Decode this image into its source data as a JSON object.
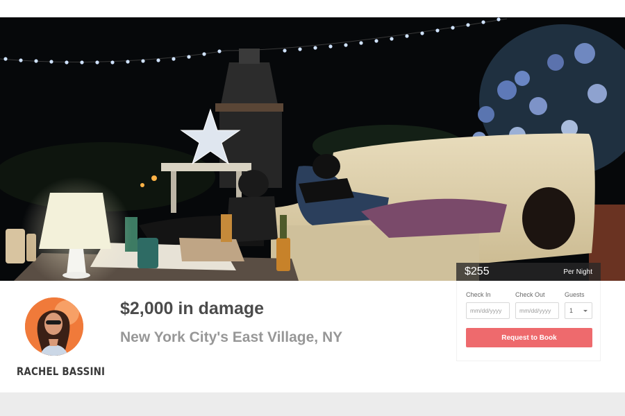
{
  "listing": {
    "title": "$2,000 in damage",
    "location": "New York City's East Village, NY"
  },
  "host": {
    "name": "RACHEL BASSINI"
  },
  "pricing": {
    "amount": "$255",
    "unit": "Per Night"
  },
  "booking": {
    "check_in_label": "Check In",
    "check_in_placeholder": "mm/dd/yyyy",
    "check_out_label": "Check Out",
    "check_out_placeholder": "mm/dd/yyyy",
    "guests_label": "Guests",
    "guests_value": "1",
    "request_button": "Request to Book"
  },
  "colors": {
    "accent": "#ee6a6d",
    "footer_band": "#ececec",
    "title_text": "#4b4b4b",
    "location_text": "#979797"
  }
}
